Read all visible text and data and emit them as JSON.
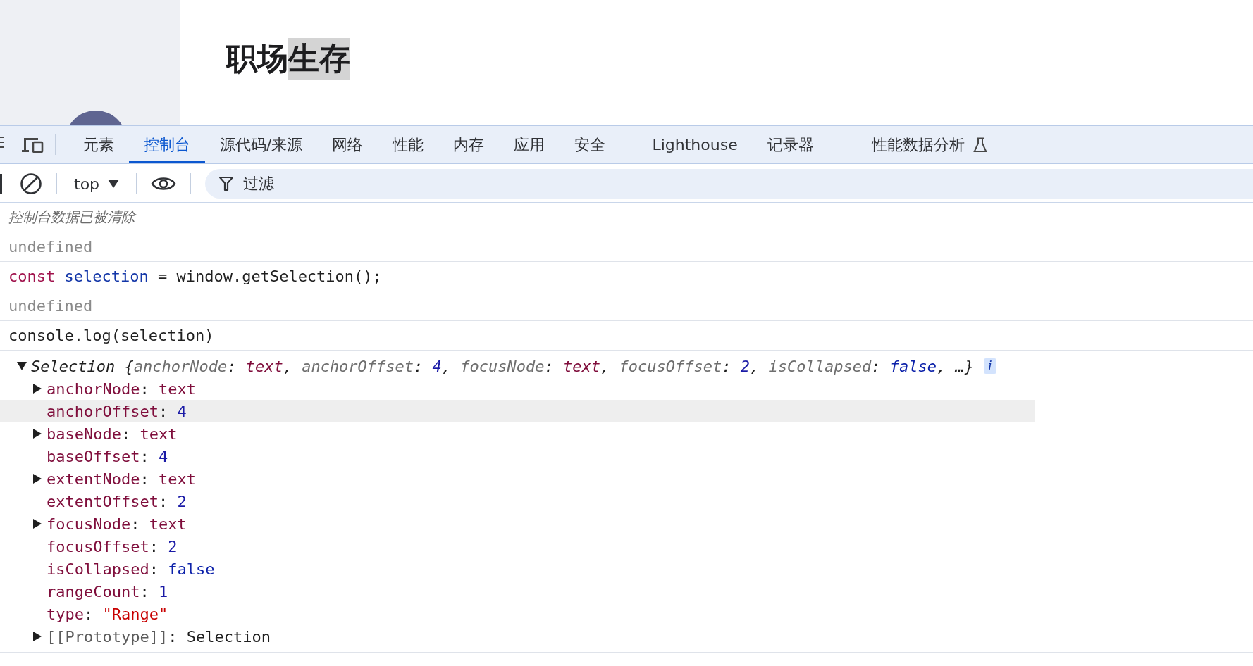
{
  "page": {
    "title_segments": [
      {
        "text": "职场",
        "selected": false
      },
      {
        "text": "生存",
        "selected": true
      }
    ]
  },
  "devtools": {
    "tabs": [
      {
        "label": "元素",
        "selected": false
      },
      {
        "label": "控制台",
        "selected": true
      },
      {
        "label": "源代码/来源",
        "selected": false
      },
      {
        "label": "网络",
        "selected": false
      },
      {
        "label": "性能",
        "selected": false
      },
      {
        "label": "内存",
        "selected": false
      },
      {
        "label": "应用",
        "selected": false
      },
      {
        "label": "安全",
        "selected": false
      },
      {
        "label": "Lighthouse",
        "selected": false
      },
      {
        "label": "记录器",
        "selected": false
      },
      {
        "label": "性能数据分析",
        "selected": false,
        "kind": "experimental"
      }
    ],
    "toolbar": {
      "context": "top",
      "filter_placeholder": "过滤"
    }
  },
  "console": {
    "entries": [
      {
        "kind": "info",
        "text": "控制台数据已被清除"
      },
      {
        "kind": "result",
        "text": "undefined"
      },
      {
        "kind": "input",
        "tokens": [
          {
            "text": "const ",
            "kind": "keyword"
          },
          {
            "text": "selection",
            "kind": "variable"
          },
          {
            "text": " = window.getSelection();",
            "kind": "plain"
          }
        ]
      },
      {
        "kind": "result",
        "text": "undefined"
      },
      {
        "kind": "input",
        "tokens": [
          {
            "text": "console.log(selection)",
            "kind": "plain"
          }
        ]
      },
      {
        "kind": "object",
        "expanded": true,
        "info_badge": "i",
        "summary": [
          {
            "text": "Selection {",
            "kind": "plain"
          },
          {
            "text": "anchorNode",
            "kind": "key"
          },
          {
            "text": ": ",
            "kind": "plain"
          },
          {
            "text": "text",
            "kind": "node"
          },
          {
            "text": ", ",
            "kind": "plain"
          },
          {
            "text": "anchorOffset",
            "kind": "key"
          },
          {
            "text": ": ",
            "kind": "plain"
          },
          {
            "text": "4",
            "kind": "number"
          },
          {
            "text": ", ",
            "kind": "plain"
          },
          {
            "text": "focusNode",
            "kind": "key"
          },
          {
            "text": ": ",
            "kind": "plain"
          },
          {
            "text": "text",
            "kind": "node"
          },
          {
            "text": ", ",
            "kind": "plain"
          },
          {
            "text": "focusOffset",
            "kind": "key"
          },
          {
            "text": ": ",
            "kind": "plain"
          },
          {
            "text": "2",
            "kind": "number"
          },
          {
            "text": ", ",
            "kind": "plain"
          },
          {
            "text": "isCollapsed",
            "kind": "key"
          },
          {
            "text": ": ",
            "kind": "plain"
          },
          {
            "text": "false",
            "kind": "boolean"
          },
          {
            "text": ", …}",
            "kind": "plain"
          }
        ],
        "properties": [
          {
            "name": "anchorNode",
            "separator": ": ",
            "value": "text",
            "kind": "node",
            "expandable": true,
            "highlighted": false
          },
          {
            "name": "anchorOffset",
            "separator": ": ",
            "value": "4",
            "kind": "number",
            "expandable": false,
            "highlighted": true
          },
          {
            "name": "baseNode",
            "separator": ": ",
            "value": "text",
            "kind": "node",
            "expandable": true,
            "highlighted": false
          },
          {
            "name": "baseOffset",
            "separator": ": ",
            "value": "4",
            "kind": "number",
            "expandable": false,
            "highlighted": false
          },
          {
            "name": "extentNode",
            "separator": ": ",
            "value": "text",
            "kind": "node",
            "expandable": true,
            "highlighted": false
          },
          {
            "name": "extentOffset",
            "separator": ": ",
            "value": "2",
            "kind": "number",
            "expandable": false,
            "highlighted": false
          },
          {
            "name": "focusNode",
            "separator": ": ",
            "value": "text",
            "kind": "node",
            "expandable": true,
            "highlighted": false
          },
          {
            "name": "focusOffset",
            "separator": ": ",
            "value": "2",
            "kind": "number",
            "expandable": false,
            "highlighted": false
          },
          {
            "name": "isCollapsed",
            "separator": ": ",
            "value": "false",
            "kind": "boolean",
            "expandable": false,
            "highlighted": false
          },
          {
            "name": "rangeCount",
            "separator": ": ",
            "value": "1",
            "kind": "number",
            "expandable": false,
            "highlighted": false
          },
          {
            "name": "type",
            "separator": ": ",
            "value": "\"Range\"",
            "kind": "string",
            "expandable": false,
            "highlighted": false
          },
          {
            "name": "[[Prototype]]",
            "separator": ": ",
            "value": "Selection",
            "kind": "internal",
            "expandable": true,
            "highlighted": false
          }
        ]
      }
    ]
  }
}
